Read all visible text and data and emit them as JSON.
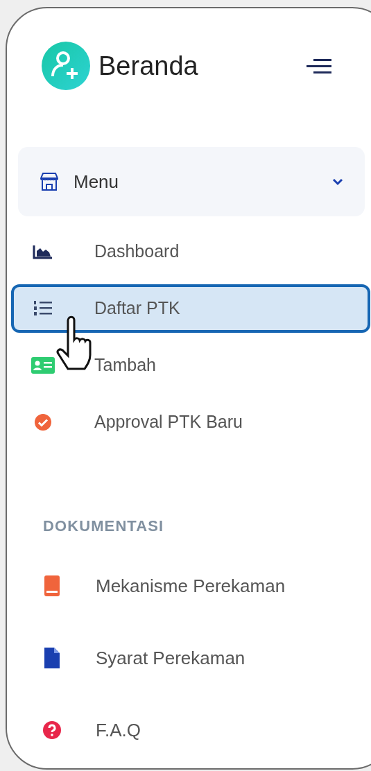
{
  "header": {
    "title": "Beranda"
  },
  "menu": {
    "label": "Menu",
    "expanded": true,
    "items": [
      {
        "label": "Dashboard",
        "selected": false,
        "color": "#1e2a5a"
      },
      {
        "label": "Daftar PTK",
        "selected": true,
        "color": "#3a4a6b"
      },
      {
        "label": "Tambah",
        "selected": false,
        "color": "#2ecc71"
      },
      {
        "label": "Approval PTK Baru",
        "selected": false,
        "color": "#f0643c"
      }
    ]
  },
  "docs": {
    "heading": "DOKUMENTASI",
    "items": [
      {
        "label": "Mekanisme Perekaman",
        "color": "#f0643c"
      },
      {
        "label": "Syarat Perekaman",
        "color": "#1a3fb0"
      },
      {
        "label": "F.A.Q",
        "color": "#e8264a"
      }
    ]
  }
}
